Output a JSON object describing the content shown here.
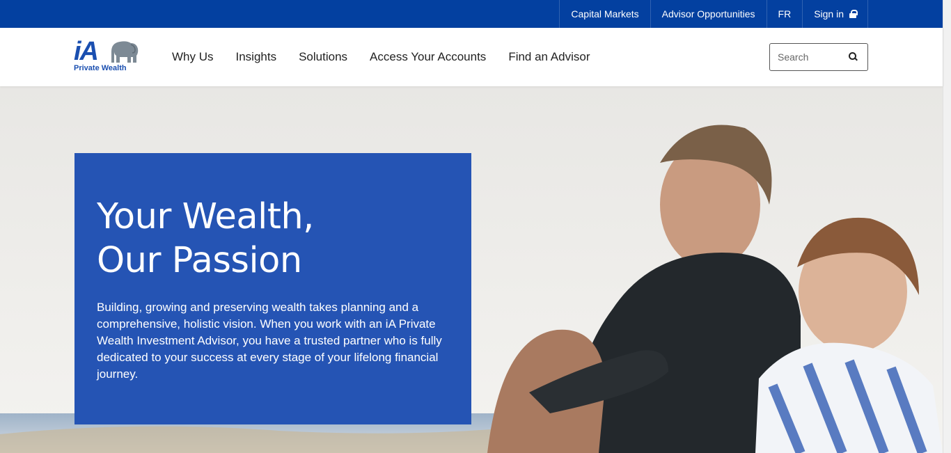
{
  "topbar": {
    "links": [
      "Capital Markets",
      "Advisor Opportunities",
      "FR",
      "Sign in"
    ]
  },
  "header": {
    "logo": {
      "main": "iA",
      "sub": "Private Wealth"
    },
    "nav": [
      "Why Us",
      "Insights",
      "Solutions",
      "Access Your Accounts",
      "Find an Advisor"
    ],
    "search": {
      "placeholder": "Search",
      "value": ""
    }
  },
  "hero": {
    "title_line1": "Your Wealth,",
    "title_line2": "Our Passion",
    "body": "Building, growing and preserving wealth takes planning and a comprehensive, holistic vision. When you work with an iA Private Wealth Investment Advisor, you have a trusted partner who is fully dedicated to your success at every stage of your lifelong financial journey."
  },
  "colors": {
    "topbar": "#0340a0",
    "brand": "#1a4fb0",
    "hero_card": "#2554b4"
  },
  "icons": [
    "lock-icon",
    "search-icon",
    "elephant-logo-icon"
  ]
}
